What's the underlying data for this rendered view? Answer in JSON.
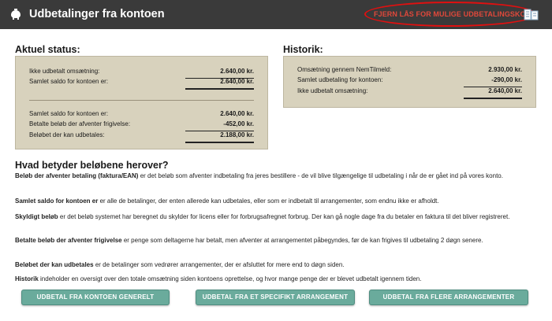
{
  "header": {
    "title": "Udbetalinger fra kontoen",
    "unlock_link": "FJERN LÅS FOR MULIGE UDBETALINGSKONTI"
  },
  "status": {
    "title": "Aktuel status:",
    "rows": [
      {
        "label": "Ikke udbetalt omsætning:",
        "value": "2.640,00 kr."
      },
      {
        "label": "Samlet saldo for kontoen er:",
        "value": "2.640,00 kr."
      },
      {
        "label": "Samlet saldo for kontoen er:",
        "value": "2.640,00 kr."
      },
      {
        "label": "Betalte beløb der afventer frigivelse:",
        "value": "-452,00 kr."
      },
      {
        "label": "Beløbet der kan udbetales:",
        "value": "2.188,00 kr."
      }
    ]
  },
  "history": {
    "title": "Historik:",
    "rows": [
      {
        "label": "Omsætning gennem NemTilmeld:",
        "value": "2.930,00 kr."
      },
      {
        "label": "Samlet udbetaling for kontoen:",
        "value": "-290,00 kr."
      },
      {
        "label": "Ikke udbetalt omsætning:",
        "value": "2.640,00 kr."
      }
    ]
  },
  "explanation": {
    "title": "Hvad betyder beløbene herover?",
    "paragraphs": [
      {
        "term": "Beløb der afventer betaling (faktura/EAN)",
        "text": " er det beløb som afventer indbetaling fra jeres bestillere - de vil blive tilgængelige til udbetaling i når de er gået ind på vores konto."
      },
      {
        "term": "Samlet saldo for kontoen er",
        "text": " er alle de betalinger, der enten allerede kan udbetales, eller som er indbetalt til arrangementer, som endnu ikke er afholdt."
      },
      {
        "term": "Skyldigt beløb",
        "text": " er det beløb systemet har beregnet du skylder for licens eller for forbrugsafregnet forbrug. Der kan gå nogle dage fra du betaler en faktura til det bliver registreret."
      },
      {
        "term": "Betalte beløb der afventer frigivelse",
        "text": " er penge som deltagerne har betalt, men afventer at arrangementet påbegyndes, før de kan frigives til udbetaling 2 døgn senere."
      },
      {
        "term": "Beløbet der kan udbetales",
        "text": " er de betalinger som vedrører arrangementer, der er afsluttet for mere end to døgn siden."
      },
      {
        "term": "Historik",
        "text": " indeholder en oversigt over den totale omsætning siden kontoens oprettelse, og hvor mange penge der er blevet udbetalt igennem tiden."
      }
    ]
  },
  "buttons": {
    "general": "UDBETAL FRA KONTOEN GENERELT",
    "specific": "UDBETAL FRA ET SPECIFIKT ARRANGEMENT",
    "multiple": "UDBETAL FRA FLERE ARRANGEMENTER"
  }
}
